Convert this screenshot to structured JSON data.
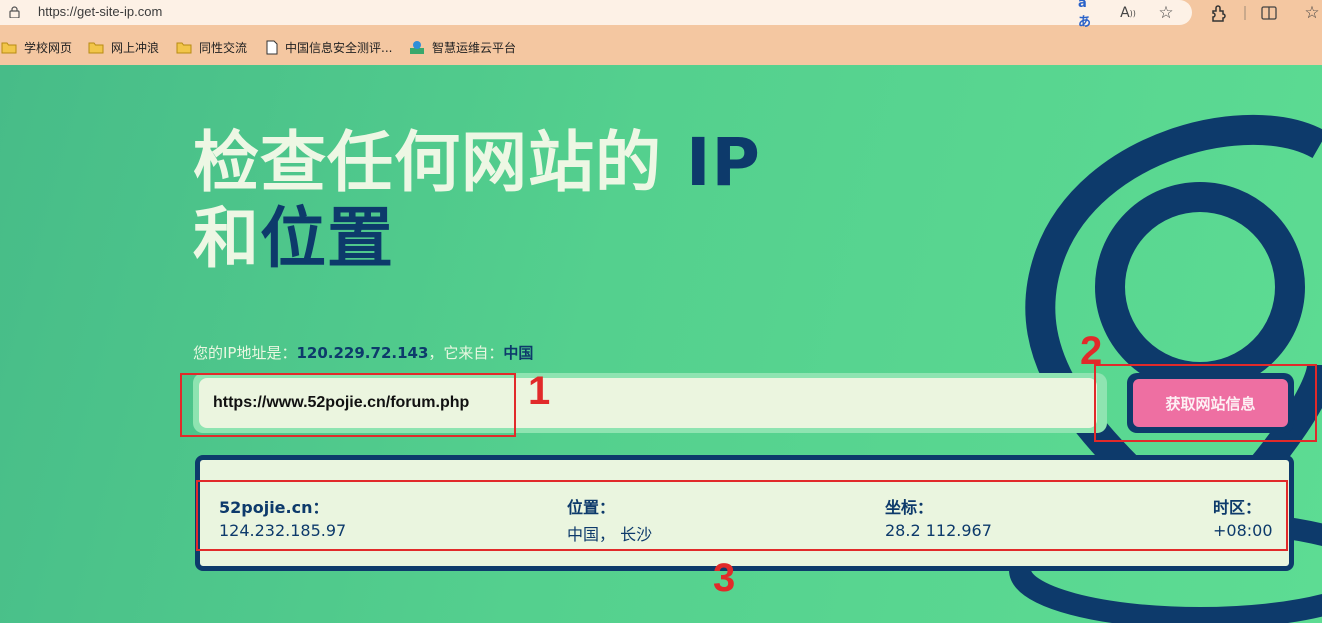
{
  "browser": {
    "url": "https://get-site-ip.com",
    "toolbar_icons": [
      "translate-icon",
      "read-aloud-icon",
      "favorite-icon",
      "extensions-icon",
      "split-screen-icon",
      "favorites-icon"
    ],
    "bookmarks": [
      {
        "icon": "folder-icon",
        "label": "学校网页"
      },
      {
        "icon": "folder-icon",
        "label": "网上冲浪"
      },
      {
        "icon": "folder-icon",
        "label": "同性交流"
      },
      {
        "icon": "page-icon",
        "label": "中国信息安全测评..."
      },
      {
        "icon": "site-icon",
        "label": "智慧运维云平台"
      }
    ]
  },
  "page": {
    "headline_line1": "检查任何网站的",
    "headline_ip": "IP",
    "headline_and": "和",
    "headline_location": "位置",
    "ip_prefix": "您的IP地址是：",
    "ip_value": "120.229.72.143",
    "from_prefix": "，它来自：",
    "country": "中国",
    "url_value": "https://www.52pojie.cn/forum.php",
    "button_label": "获取网站信息",
    "colors": {
      "accent_dark": "#0d3a6b",
      "button_pink": "#ee6fa2",
      "background_green": "#54d08e"
    }
  },
  "result": {
    "domain_label": "52pojie.cn：",
    "domain_ip": "124.232.185.97",
    "location_label": "位置：",
    "location_value": "中国， 长沙",
    "coords_label": "坐标：",
    "coords_value": "28.2 112.967",
    "timezone_label": "时区：",
    "timezone_value": "+08:00"
  },
  "annotations": {
    "label_1": "1",
    "label_2": "2",
    "label_3": "3",
    "color": "#e12a2a"
  }
}
